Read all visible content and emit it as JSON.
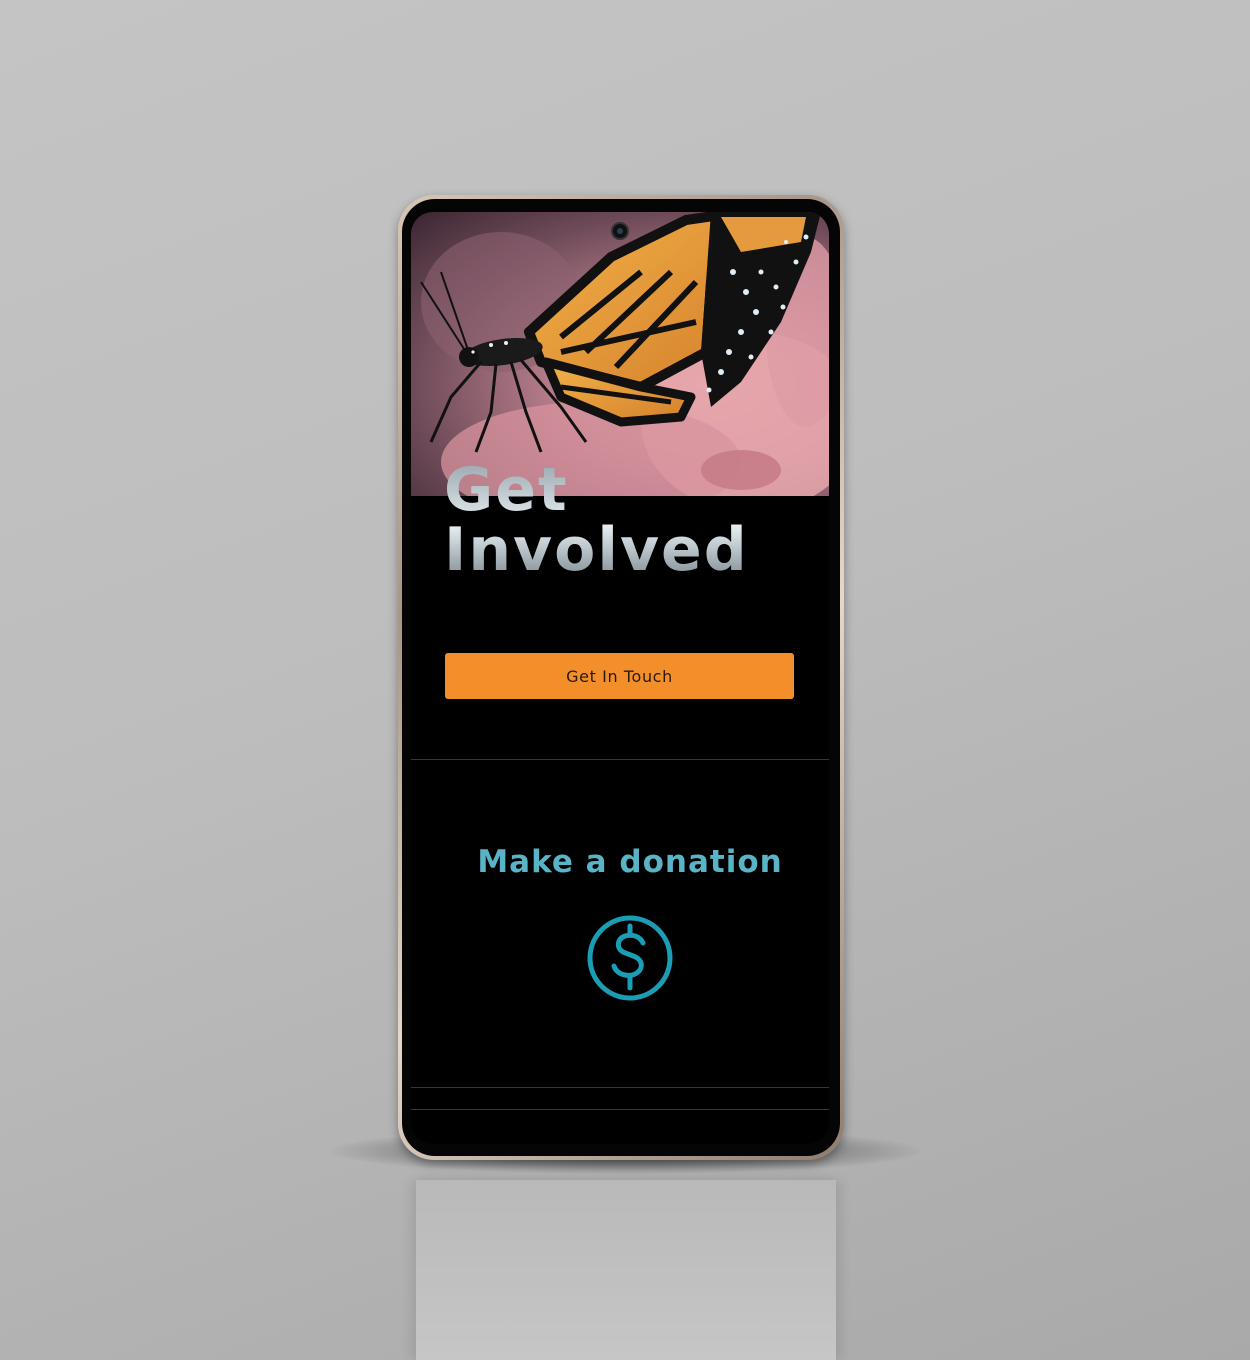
{
  "hero": {
    "headline_line1": "Get",
    "headline_line2": "Involved"
  },
  "cta": {
    "label": "Get In Touch",
    "color": "#f28f2b"
  },
  "donation": {
    "title": "Make a donation",
    "icon": "dollar-circle-icon",
    "color": "#1b9eb5"
  }
}
